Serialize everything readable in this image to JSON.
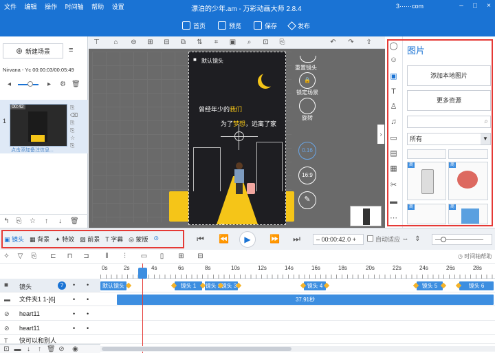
{
  "menu": [
    "文件",
    "编辑",
    "操作",
    "时间轴",
    "帮助",
    "设置"
  ],
  "window_title": "漂泊的少年.am - 万彩动画大师 2.8.4",
  "account": "3······com",
  "toolbar": {
    "home": "首页",
    "preview": "预览",
    "save": "保存",
    "publish": "发布"
  },
  "left": {
    "new_scene": "新建场景",
    "track_info": "Nirvana - Yc  00:00:03/00:05:49",
    "scene_number": "1",
    "scene_time": "00:42",
    "scene_note": "点击添加备注信息..."
  },
  "phone": {
    "camera_label": "默认镜头",
    "line1_a": "曾经年少的",
    "line1_b": "我们",
    "line2_a": "为了",
    "line2_b": "梦想",
    "line2_c": "，远离了家"
  },
  "canvas_side": {
    "reset": "重置镜头",
    "lock": "锁定场景",
    "rotate": "旋转",
    "zoom": "0.16",
    "ratio": "16:9"
  },
  "right": {
    "title": "图片",
    "add_local": "添加本地图片",
    "more": "更多资源",
    "filter": "所有",
    "tag": "商"
  },
  "secbar": {
    "tabs": [
      "镜头",
      "背景",
      "特效",
      "前景",
      "字幕",
      "蒙版"
    ],
    "time": "00:00:42.0",
    "auto_fit": "自动适应"
  },
  "timeline": {
    "ruler": [
      "0s",
      "2s",
      "4s",
      "6s",
      "8s",
      "10s",
      "12s",
      "14s",
      "16s",
      "18s",
      "20s",
      "22s",
      "24s",
      "26s",
      "28s"
    ],
    "help_link": "时间轴帮助",
    "tracks": [
      "镜头",
      "文件夹1 1-[6]",
      "heart11",
      "heart11",
      "快可以和别人"
    ],
    "camera_clips": [
      "默认镜头",
      "镜头 1",
      "镜头 2",
      "镜头 3",
      "镜头 4",
      "镜头 5",
      "镜头 6"
    ],
    "folder_duration": "37.91秒"
  },
  "colors": {
    "accent": "#1a73d4",
    "highlight": "#e53935",
    "keyframe": "#f4b32a",
    "clip": "#3d8ee0",
    "text_yellow": "#f5c518"
  }
}
